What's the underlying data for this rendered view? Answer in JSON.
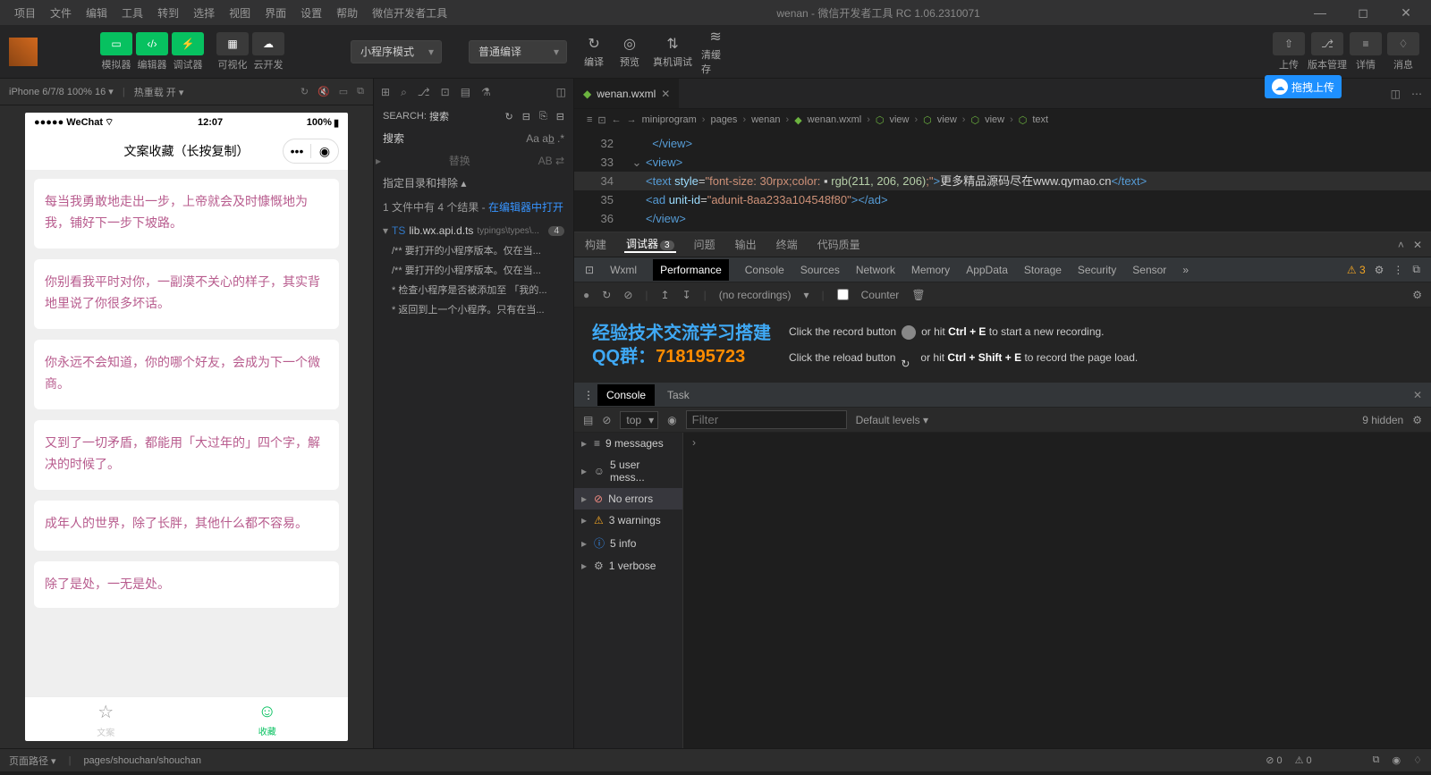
{
  "window": {
    "title": "wenan - 微信开发者工具 RC 1.06.2310071",
    "menu": [
      "项目",
      "文件",
      "编辑",
      "工具",
      "转到",
      "选择",
      "视图",
      "界面",
      "设置",
      "帮助",
      "微信开发者工具"
    ]
  },
  "toolbar": {
    "modes": [
      {
        "label": "模拟器",
        "icon": "▭"
      },
      {
        "label": "编辑器",
        "icon": "</>"
      },
      {
        "label": "调试器",
        "icon": "⚡"
      }
    ],
    "gray_modes": [
      {
        "label": "可视化",
        "icon": "▦"
      },
      {
        "label": "云开发",
        "icon": "☁"
      }
    ],
    "mode_select": "小程序模式",
    "compile_select": "普通编译",
    "actions": [
      {
        "label": "编译",
        "icon": "↻"
      },
      {
        "label": "预览",
        "icon": "◎"
      },
      {
        "label": "真机调试",
        "icon": "⇅"
      },
      {
        "label": "清缓存",
        "icon": "≋"
      }
    ],
    "right": [
      {
        "label": "上传",
        "icon": "⇧"
      },
      {
        "label": "版本管理",
        "icon": "⎇"
      },
      {
        "label": "详情",
        "icon": "≡"
      },
      {
        "label": "消息",
        "icon": "♢"
      }
    ]
  },
  "sim": {
    "device": "iPhone 6/7/8 100% 16 ▾",
    "hot": "热重载 开 ▾",
    "phone": {
      "carrier": "●●●●● WeChat",
      "wifi": "⌔",
      "time": "12:07",
      "battery": "100%",
      "title": "文案收藏（长按复制）",
      "cards": [
        "每当我勇敢地走出一步，上帝就会及时慷慨地为我，铺好下一步下坡路。",
        "你别看我平时对你，一副漠不关心的样子，其实背地里说了你很多坏话。",
        "你永远不会知道，你的哪个好友，会成为下一个微商。",
        "又到了一切矛盾，都能用「大过年的」四个字，解决的时候了。",
        "成年人的世界，除了长胖，其他什么都不容易。",
        "除了是处，一无是处。"
      ],
      "tabs": [
        {
          "label": "文案",
          "icon": "☆"
        },
        {
          "label": "收藏",
          "icon": "☺"
        }
      ]
    }
  },
  "search": {
    "header": "SEARCH:",
    "query": "搜索",
    "replace": "替换",
    "exclude": "指定目录和排除 ▴",
    "result_info": "1 文件中有 4 个结果 - ",
    "open_link": "在编辑器中打开",
    "file": "lib.wx.api.d.ts",
    "file_path": "typings\\types\\...",
    "badge": "4",
    "matches": [
      "/** 要打开的小程序版本。仅在当...",
      "/** 要打开的小程序版本。仅在当...",
      "* 检查小程序是否被添加至 「我的...",
      "* 返回到上一个小程序。只有在当..."
    ]
  },
  "editor": {
    "tab": "wenan.wxml",
    "crumbs": [
      "miniprogram",
      "pages",
      "wenan",
      "wenan.wxml",
      "view",
      "view",
      "view",
      "text"
    ],
    "lines": [
      {
        "n": "32",
        "html": "  <span class='tg'>&lt;/view&gt;</span>"
      },
      {
        "n": "33",
        "html": "<span class='tg'>&lt;view&gt;</span>"
      },
      {
        "n": "34",
        "html": "<span class='tg'>&lt;text</span> <span class='attr'>style</span>=<span class='str'>\"font-size: 30rpx;color: </span>▪ <span class='rgb'>rgb(211, 206, 206)</span><span class='str'>;\"</span><span class='tg'>&gt;</span><span class='w'>更多精品源码尽在www.qymao.cn</span><span class='tg'>&lt;/text&gt;</span>"
      },
      {
        "n": "35",
        "html": "<span class='tg'>&lt;ad</span> <span class='attr'>unit-id</span>=<span class='str'>\"adunit-8aa233a104548f80\"</span><span class='tg'>&gt;&lt;/ad&gt;</span>"
      },
      {
        "n": "36",
        "html": "<span class='tg'>&lt;/view&gt;</span>"
      }
    ]
  },
  "devtools": {
    "top_tabs": [
      "构建",
      "调试器",
      "问题",
      "输出",
      "终端",
      "代码质量"
    ],
    "top_active": "调试器",
    "top_badge": "3",
    "sub_tabs": [
      "Wxml",
      "Performance",
      "Console",
      "Sources",
      "Network",
      "Memory",
      "AppData",
      "Storage",
      "Security",
      "Sensor"
    ],
    "sub_active": "Performance",
    "warn_count": "3",
    "perf": {
      "no_rec": "(no recordings)",
      "counter": "Counter",
      "logo_l1": "经验技术交流学习搭建",
      "logo_l2": "QQ群：",
      "logo_num": "718195723",
      "inst1_a": "Click the record button",
      "inst1_b": "or hit ",
      "inst1_k": "Ctrl + E",
      "inst1_c": " to start a new recording.",
      "inst2_a": "Click the reload button",
      "inst2_b": "or hit ",
      "inst2_k": "Ctrl + Shift + E",
      "inst2_c": " to record the page load."
    },
    "console": {
      "tabs": [
        "Console",
        "Task"
      ],
      "active": "Console",
      "scope": "top",
      "filter_ph": "Filter",
      "levels": "Default levels ▾",
      "hidden": "9 hidden",
      "side": [
        {
          "icon": "≡",
          "label": "9 messages"
        },
        {
          "icon": "☺",
          "label": "5 user mess..."
        },
        {
          "icon": "⊘",
          "label": "No errors",
          "sel": true,
          "red": true
        },
        {
          "icon": "⚠",
          "label": "3 warnings",
          "warn": true
        },
        {
          "icon": "ⓘ",
          "label": "5 info",
          "info": true
        },
        {
          "icon": "⚙",
          "label": "1 verbose"
        }
      ]
    }
  },
  "statusbar": {
    "path_label": "页面路径 ▾",
    "path": "pages/shouchan/shouchan",
    "err": "⊘ 0",
    "warn": "⚠ 0"
  },
  "float_badge": "拖拽上传"
}
